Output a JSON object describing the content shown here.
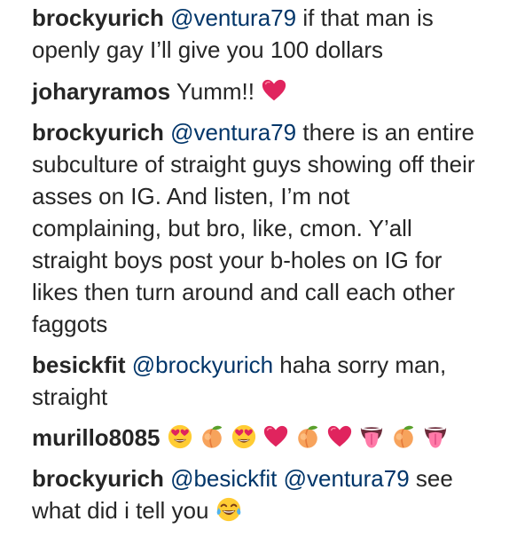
{
  "comments": [
    {
      "username": "brockyurich",
      "mentions": [
        "@ventura79"
      ],
      "text": "if that man is openly gay I’ll give you 100 dollars"
    },
    {
      "username": "joharyramos",
      "text": "Yumm!!",
      "emojis": [
        "red-heart-icon"
      ]
    },
    {
      "username": "brockyurich",
      "mentions": [
        "@ventura79"
      ],
      "text": "there is an entire subculture of straight guys showing off their asses on IG. And listen, I’m not complaining, but bro, like, cmon. Y’all straight boys post your b-holes on IG for likes then turn around and call each other faggots"
    },
    {
      "username": "besickfit",
      "mentions": [
        "@brockyurich"
      ],
      "text": "haha sorry man, straight"
    },
    {
      "username": "murillo8085",
      "text": "",
      "emojis": [
        "heart-eyes-face-icon",
        "peach-icon",
        "heart-eyes-face-icon",
        "red-heart-icon",
        "peach-icon",
        "red-heart-icon",
        "tongue-icon",
        "peach-icon",
        "tongue-icon"
      ]
    },
    {
      "username": "brockyurich",
      "mentions": [
        "@besickfit",
        "@ventura79"
      ],
      "text": "see what did i tell you",
      "emojis": [
        "tears-of-joy-face-icon"
      ]
    }
  ],
  "colors": {
    "text": "#262626",
    "mention": "#003569",
    "heart": "#e0245e",
    "peach": "#f7a35c"
  }
}
